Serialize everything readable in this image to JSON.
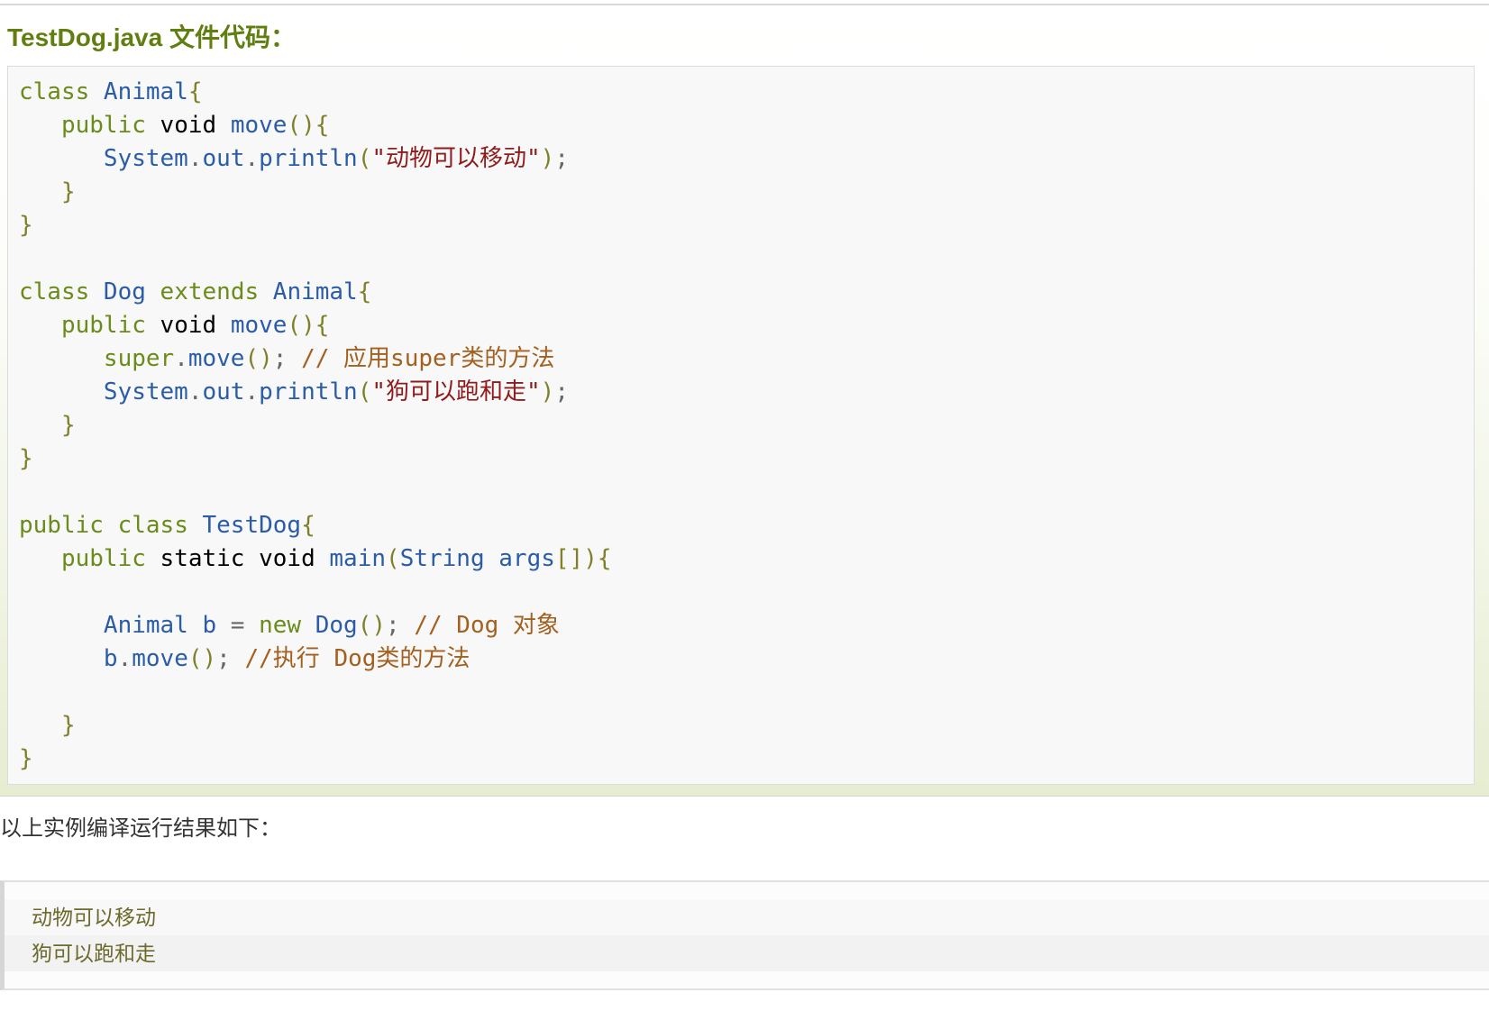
{
  "example": {
    "title": "TestDog.java 文件代码：",
    "code": {
      "lines": [
        {
          "tokens": [
            {
              "t": "class",
              "c": "#6b8b1b"
            },
            {
              "t": " Animal",
              "c": "#2a5ca8"
            },
            {
              "t": "{",
              "c": "#80802a"
            }
          ]
        },
        {
          "tokens": [
            {
              "t": "   public",
              "c": "#6b8b1b"
            },
            {
              "t": " void",
              "c": "#000000"
            },
            {
              "t": " move",
              "c": "#2a5ca8"
            },
            {
              "t": "(){",
              "c": "#80802a"
            }
          ]
        },
        {
          "tokens": [
            {
              "t": "      System",
              "c": "#2a5ca8"
            },
            {
              "t": ".",
              "c": "#666666"
            },
            {
              "t": "out",
              "c": "#2a5ca8"
            },
            {
              "t": ".",
              "c": "#666666"
            },
            {
              "t": "println",
              "c": "#2a5ca8"
            },
            {
              "t": "(",
              "c": "#80802a"
            },
            {
              "t": "\"动物可以移动\"",
              "c": "#8f1c1c"
            },
            {
              "t": ")",
              "c": "#80802a"
            },
            {
              "t": ";",
              "c": "#666666"
            }
          ]
        },
        {
          "tokens": [
            {
              "t": "   }",
              "c": "#80802a"
            }
          ]
        },
        {
          "tokens": [
            {
              "t": "}",
              "c": "#80802a"
            }
          ]
        },
        {
          "tokens": []
        },
        {
          "tokens": [
            {
              "t": "class",
              "c": "#6b8b1b"
            },
            {
              "t": " Dog",
              "c": "#2a5ca8"
            },
            {
              "t": " extends",
              "c": "#6b8b1b"
            },
            {
              "t": " Animal",
              "c": "#2a5ca8"
            },
            {
              "t": "{",
              "c": "#80802a"
            }
          ]
        },
        {
          "tokens": [
            {
              "t": "   public",
              "c": "#6b8b1b"
            },
            {
              "t": " void",
              "c": "#000000"
            },
            {
              "t": " move",
              "c": "#2a5ca8"
            },
            {
              "t": "(){",
              "c": "#80802a"
            }
          ]
        },
        {
          "tokens": [
            {
              "t": "      super",
              "c": "#6b8b1b"
            },
            {
              "t": ".",
              "c": "#666666"
            },
            {
              "t": "move",
              "c": "#2a5ca8"
            },
            {
              "t": "()",
              "c": "#80802a"
            },
            {
              "t": ";",
              "c": "#666666"
            },
            {
              "t": " // 应用super类的方法",
              "c": "#a3601e"
            }
          ]
        },
        {
          "tokens": [
            {
              "t": "      System",
              "c": "#2a5ca8"
            },
            {
              "t": ".",
              "c": "#666666"
            },
            {
              "t": "out",
              "c": "#2a5ca8"
            },
            {
              "t": ".",
              "c": "#666666"
            },
            {
              "t": "println",
              "c": "#2a5ca8"
            },
            {
              "t": "(",
              "c": "#80802a"
            },
            {
              "t": "\"狗可以跑和走\"",
              "c": "#8f1c1c"
            },
            {
              "t": ")",
              "c": "#80802a"
            },
            {
              "t": ";",
              "c": "#666666"
            }
          ]
        },
        {
          "tokens": [
            {
              "t": "   }",
              "c": "#80802a"
            }
          ]
        },
        {
          "tokens": [
            {
              "t": "}",
              "c": "#80802a"
            }
          ]
        },
        {
          "tokens": []
        },
        {
          "tokens": [
            {
              "t": "public",
              "c": "#6b8b1b"
            },
            {
              "t": " class",
              "c": "#6b8b1b"
            },
            {
              "t": " TestDog",
              "c": "#2a5ca8"
            },
            {
              "t": "{",
              "c": "#80802a"
            }
          ]
        },
        {
          "tokens": [
            {
              "t": "   public",
              "c": "#6b8b1b"
            },
            {
              "t": " static",
              "c": "#000000"
            },
            {
              "t": " void",
              "c": "#000000"
            },
            {
              "t": " main",
              "c": "#2a5ca8"
            },
            {
              "t": "(",
              "c": "#80802a"
            },
            {
              "t": "String",
              "c": "#2a5ca8"
            },
            {
              "t": " args",
              "c": "#2a5ca8"
            },
            {
              "t": "[]){",
              "c": "#80802a"
            }
          ]
        },
        {
          "tokens": []
        },
        {
          "tokens": [
            {
              "t": "      Animal",
              "c": "#2a5ca8"
            },
            {
              "t": " b",
              "c": "#2a5ca8"
            },
            {
              "t": " =",
              "c": "#666666"
            },
            {
              "t": " new",
              "c": "#6b8b1b"
            },
            {
              "t": " Dog",
              "c": "#2a5ca8"
            },
            {
              "t": "()",
              "c": "#80802a"
            },
            {
              "t": ";",
              "c": "#666666"
            },
            {
              "t": " // Dog 对象",
              "c": "#a3601e"
            }
          ]
        },
        {
          "tokens": [
            {
              "t": "      b",
              "c": "#2a5ca8"
            },
            {
              "t": ".",
              "c": "#666666"
            },
            {
              "t": "move",
              "c": "#2a5ca8"
            },
            {
              "t": "()",
              "c": "#80802a"
            },
            {
              "t": ";",
              "c": "#666666"
            },
            {
              "t": " //执行 Dog类的方法",
              "c": "#a3601e"
            }
          ]
        },
        {
          "tokens": []
        },
        {
          "tokens": [
            {
              "t": "   }",
              "c": "#80802a"
            }
          ]
        },
        {
          "tokens": [
            {
              "t": "}",
              "c": "#80802a"
            }
          ]
        }
      ]
    }
  },
  "result": {
    "label": "以上实例编译运行结果如下：",
    "output_lines": [
      "动物可以移动",
      "狗可以跑和走"
    ]
  },
  "colors": {
    "title": "#617f10",
    "code_background": "#f8f8f8",
    "output_text": "#6c6a2c",
    "section_tint": "#e6edd1"
  }
}
